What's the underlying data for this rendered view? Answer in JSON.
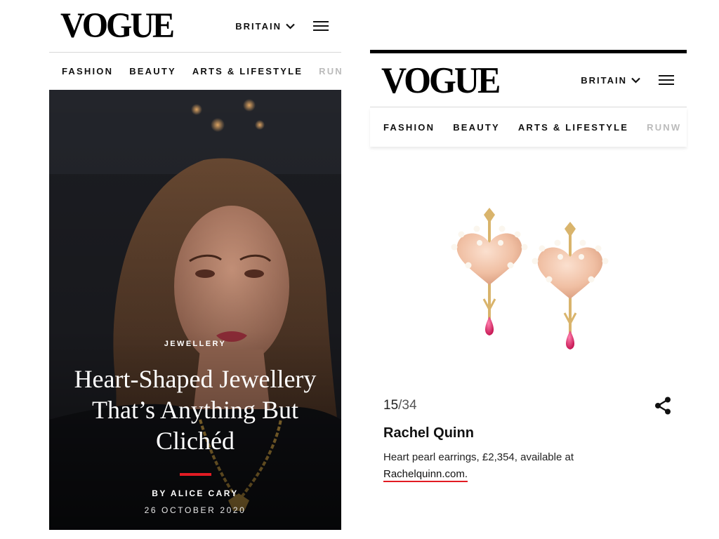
{
  "left": {
    "logo": "VOGUE",
    "edition": "BRITAIN",
    "nav": [
      "FASHION",
      "BEAUTY",
      "ARTS & LIFESTYLE",
      "RUNW"
    ],
    "article": {
      "category": "JEWELLERY",
      "headline": "Heart-Shaped Jewellery That’s Anything But Clichéd",
      "byline": "BY ALICE CARY",
      "date": "26 OCTOBER 2020"
    }
  },
  "right": {
    "logo": "VOGUE",
    "edition": "BRITAIN",
    "nav": [
      "FASHION",
      "BEAUTY",
      "ARTS & LIFESTYLE",
      "RUNW"
    ],
    "slide": {
      "current": "15",
      "separator": "/",
      "total": "34"
    },
    "product": {
      "brand": "Rachel Quinn",
      "description": "Heart pearl earrings, £2,354, available at",
      "link": "Rachelquinn.com."
    }
  },
  "icons": {
    "chevron": "chevron-down-icon",
    "menu": "hamburger-menu-icon",
    "share": "share-icon"
  },
  "colors": {
    "accent": "#e21b23",
    "rose_gold": "#f0c3a8",
    "ruby": "#e0226e",
    "gold": "#d9b46c"
  }
}
